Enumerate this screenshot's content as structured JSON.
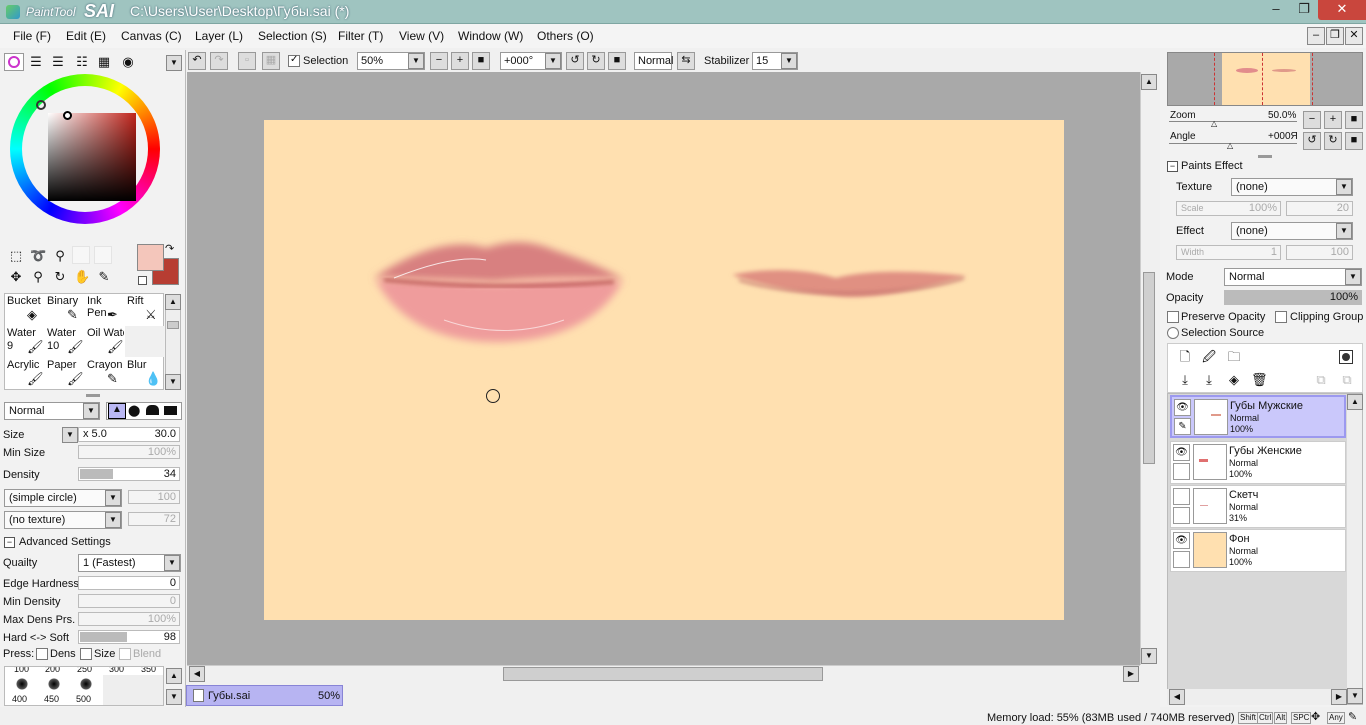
{
  "window": {
    "app_name_small": "PaintTool",
    "app_name_big": "SAI",
    "title": "C:\\Users\\User\\Desktop\\Губы.sai (*)",
    "minimize": "–",
    "maximize": "❐",
    "close": "✕"
  },
  "menu": [
    "File (F)",
    "Edit (E)",
    "Canvas (C)",
    "Layer (L)",
    "Selection (S)",
    "Filter (T)",
    "View (V)",
    "Window (W)",
    "Others (O)"
  ],
  "toolbar": {
    "selection_label": "Selection",
    "zoom": "50%",
    "angle": "+000°",
    "mode": "Normal",
    "stabilizer_label": "Stabilizer",
    "stabilizer": "15"
  },
  "colors": {
    "accent": "#b7b4f2",
    "canvas_bg": "#a9a9a9",
    "paper": "#ffe0b0",
    "fg_color": "#f4c6bb",
    "bg_color": "#b73d32"
  },
  "tools": [
    {
      "name": "Bucket"
    },
    {
      "name": "Binary"
    },
    {
      "name": "Ink Pen"
    },
    {
      "name": "Rift"
    },
    {
      "name": "Water",
      "num": "9"
    },
    {
      "name": "Water",
      "num": "10"
    },
    {
      "name": "Oil Water"
    },
    {
      "name": ""
    },
    {
      "name": "Acrylic"
    },
    {
      "name": "Paper"
    },
    {
      "name": "Crayon"
    },
    {
      "name": "Blur"
    }
  ],
  "brush": {
    "blend_mode": "Normal",
    "size_label": "Size",
    "size_mult": "x 5.0",
    "size": "30.0",
    "min_size_label": "Min Size",
    "min_size": "100%",
    "density_label": "Density",
    "density": "34",
    "density_frac": 0.34,
    "shape": "(simple circle)",
    "shape_val": "100",
    "texture": "(no texture)",
    "texture_val": "72",
    "advanced_label": "Advanced Settings",
    "quality_label": "Quailty",
    "quality": "1 (Fastest)",
    "edge_hardness_label": "Edge Hardness",
    "edge_hardness": "0",
    "min_density_label": "Min Density",
    "min_density": "0",
    "max_dens_label": "Max Dens Prs.",
    "max_dens": "100%",
    "hard_soft_label": "Hard <-> Soft",
    "hard_soft": "98",
    "hard_soft_frac": 0.98,
    "press_label": "Press:",
    "dens": "Dens",
    "size_chk": "Size",
    "blend": "Blend"
  },
  "brush_sizes_top": [
    "100",
    "200",
    "250",
    "300",
    "350"
  ],
  "brush_sizes": [
    "400",
    "450",
    "500"
  ],
  "tab": {
    "name": "Губы.sai",
    "zoom": "50%"
  },
  "status": {
    "memory": "Memory load: 55% (83MB used / 740MB reserved)",
    "keys": [
      "Shift",
      "Ctrl",
      "Alt",
      "SPC",
      "Any"
    ]
  },
  "navigator": {
    "zoom_label": "Zoom",
    "zoom": "50.0%",
    "angle_label": "Angle",
    "angle": "+000Я"
  },
  "paints_effect": {
    "title": "Paints Effect",
    "texture_label": "Texture",
    "texture": "(none)",
    "scale_label": "Scale",
    "scale": "100%",
    "scale2": "20",
    "effect_label": "Effect",
    "effect": "(none)",
    "width_label": "Width",
    "width": "1",
    "width2": "100"
  },
  "layer_props": {
    "mode_label": "Mode",
    "mode": "Normal",
    "opacity_label": "Opacity",
    "opacity": "100%",
    "preserve": "Preserve Opacity",
    "clipping": "Clipping Group",
    "selection_source": "Selection Source"
  },
  "layers": [
    {
      "name": "Губы Мужские",
      "mode": "Normal",
      "opacity": "100%",
      "visible": true,
      "active": true
    },
    {
      "name": "Губы Женские",
      "mode": "Normal",
      "opacity": "100%",
      "visible": true,
      "active": false
    },
    {
      "name": "Скетч",
      "mode": "Normal",
      "opacity": "31%",
      "visible": false,
      "active": false
    },
    {
      "name": "Фон",
      "mode": "Normal",
      "opacity": "100%",
      "visible": true,
      "active": false
    }
  ]
}
